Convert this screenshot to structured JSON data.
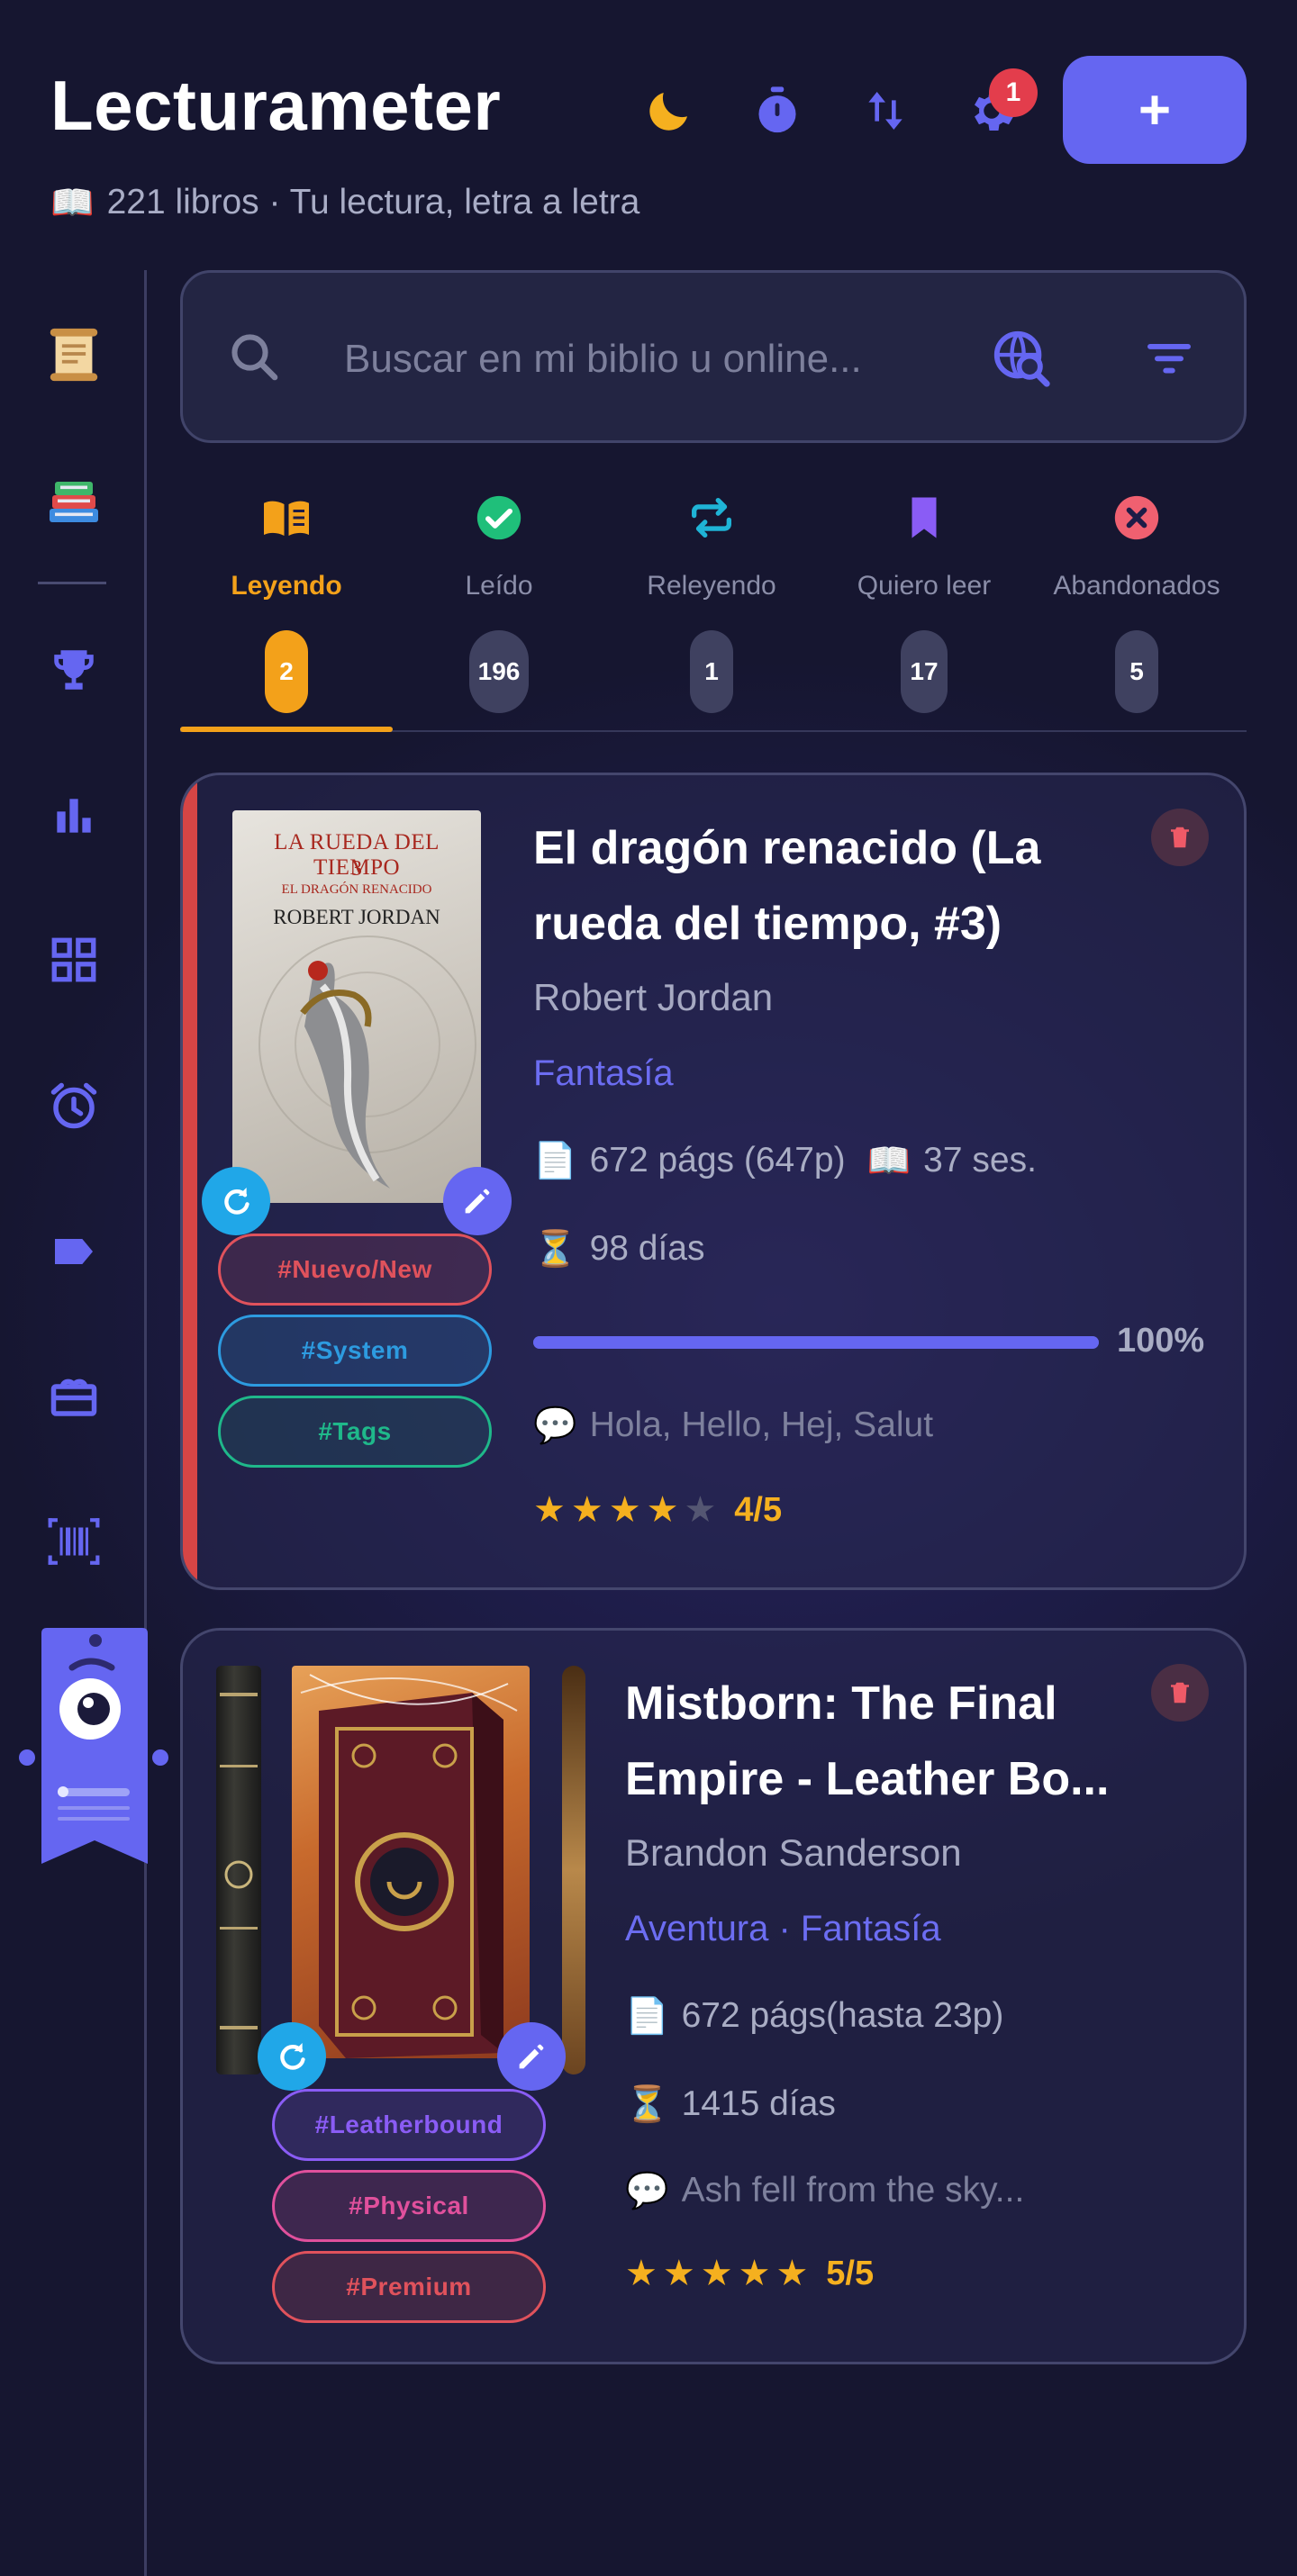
{
  "header": {
    "title": "Lecturameter",
    "subtitle_emoji": "📖",
    "subtitle": "221 libros · Tu lectura, letra a letra",
    "settings_badge": "1",
    "add_label": "+"
  },
  "search": {
    "placeholder": "Buscar en mi biblio u online...",
    "value": ""
  },
  "tabs": [
    {
      "label": "Leyendo",
      "count": "2",
      "icon": "open-book-icon",
      "color": "#f3a11a",
      "active": true
    },
    {
      "label": "Leído",
      "count": "196",
      "icon": "check-circle-icon",
      "color": "#1fbf7a",
      "active": false
    },
    {
      "label": "Releyendo",
      "count": "1",
      "icon": "repeat-icon",
      "color": "#1fb4d6",
      "active": false
    },
    {
      "label": "Quiero leer",
      "count": "17",
      "icon": "bookmark-icon",
      "color": "#8a5cf5",
      "active": false
    },
    {
      "label": "Abandonados",
      "count": "5",
      "icon": "x-circle-icon",
      "color": "#f06070",
      "active": false
    }
  ],
  "books": [
    {
      "title_line1": "El dragón renacido (La",
      "title_line2": "rueda del tiempo, #3)",
      "author": "Robert Jordan",
      "genres": "Fantasía",
      "pages_emoji": "📄",
      "pages": "672 págs (647p)",
      "sessions_emoji": "📖",
      "sessions": "37 ses.",
      "days_emoji": "⏳",
      "days": "98 días",
      "progress": 1.0,
      "progress_label": "100%",
      "quote_emoji": "💬",
      "quote": "Hola, Hello, Hej, Salut",
      "rating_value": 4,
      "rating_max": 5,
      "rating_label": "4/5",
      "cover": {
        "title_top": "LA RUEDA DEL TIEMPO",
        "number": "3",
        "subtitle": "EL DRAGÓN RENACIDO",
        "author": "ROBERT JORDAN"
      },
      "tags": [
        {
          "label": "#Nuevo/New",
          "color": "#e0525c"
        },
        {
          "label": "#System",
          "color": "#2d9be0"
        },
        {
          "label": "#Tags",
          "color": "#1fb88a"
        }
      ],
      "accent": "#d64545"
    },
    {
      "title_line1": "Mistborn: The Final",
      "title_line2": "Empire - Leather Bo...",
      "author": "Brandon Sanderson",
      "genres": "Aventura · Fantasía",
      "pages_emoji": "📄",
      "pages": "672 págs(hasta 23p)",
      "days_emoji": "⏳",
      "days": "1415 días",
      "quote_emoji": "💬",
      "quote": "Ash fell from the sky...",
      "rating_value": 5,
      "rating_max": 5,
      "rating_label": "5/5",
      "tags": [
        {
          "label": "#Leatherbound",
          "color": "#8a5cf5"
        },
        {
          "label": "#Physical",
          "color": "#e0509c"
        },
        {
          "label": "#Premium",
          "color": "#e0525c"
        }
      ]
    }
  ]
}
